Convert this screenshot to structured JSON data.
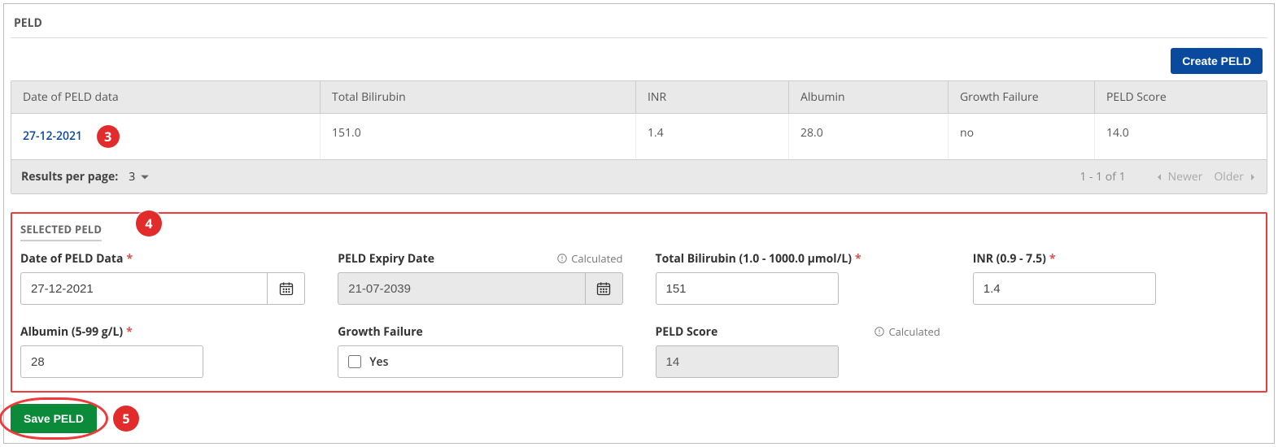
{
  "section": {
    "title": "PELD"
  },
  "toolbar": {
    "create_label": "Create PELD"
  },
  "table": {
    "headers": {
      "date": "Date of PELD data",
      "bilirubin": "Total Bilirubin",
      "inr": "INR",
      "albumin": "Albumin",
      "growth_failure": "Growth Failure",
      "score": "PELD Score"
    },
    "rows": [
      {
        "date": "27-12-2021",
        "bilirubin": "151.0",
        "inr": "1.4",
        "albumin": "28.0",
        "growth_failure": "no",
        "score": "14.0"
      }
    ],
    "footer": {
      "rpp_label": "Results per page:",
      "rpp_value": "3",
      "range": "1 - 1 of 1",
      "newer_label": "Newer",
      "older_label": "Older"
    }
  },
  "selected": {
    "title": "SELECTED PELD",
    "fields": {
      "date": {
        "label": "Date of PELD Data",
        "value": "27-12-2021",
        "required": true
      },
      "expiry": {
        "label": "PELD Expiry Date",
        "value": "21-07-2039",
        "calculated": "Calculated"
      },
      "bilirubin": {
        "label": "Total Bilirubin (1.0 - 1000.0 µmol/L)",
        "value": "151",
        "required": true
      },
      "inr": {
        "label": "INR (0.9 - 7.5)",
        "value": "1.4",
        "required": true
      },
      "albumin": {
        "label": "Albumin (5-99 g/L)",
        "value": "28",
        "required": true
      },
      "growth": {
        "label": "Growth Failure",
        "option": "Yes"
      },
      "score": {
        "label": "PELD Score",
        "value": "14",
        "calculated": "Calculated"
      }
    }
  },
  "savebar": {
    "save_label": "Save PELD"
  },
  "callouts": {
    "n3": "3",
    "n4": "4",
    "n5": "5"
  },
  "asterisk": "*"
}
